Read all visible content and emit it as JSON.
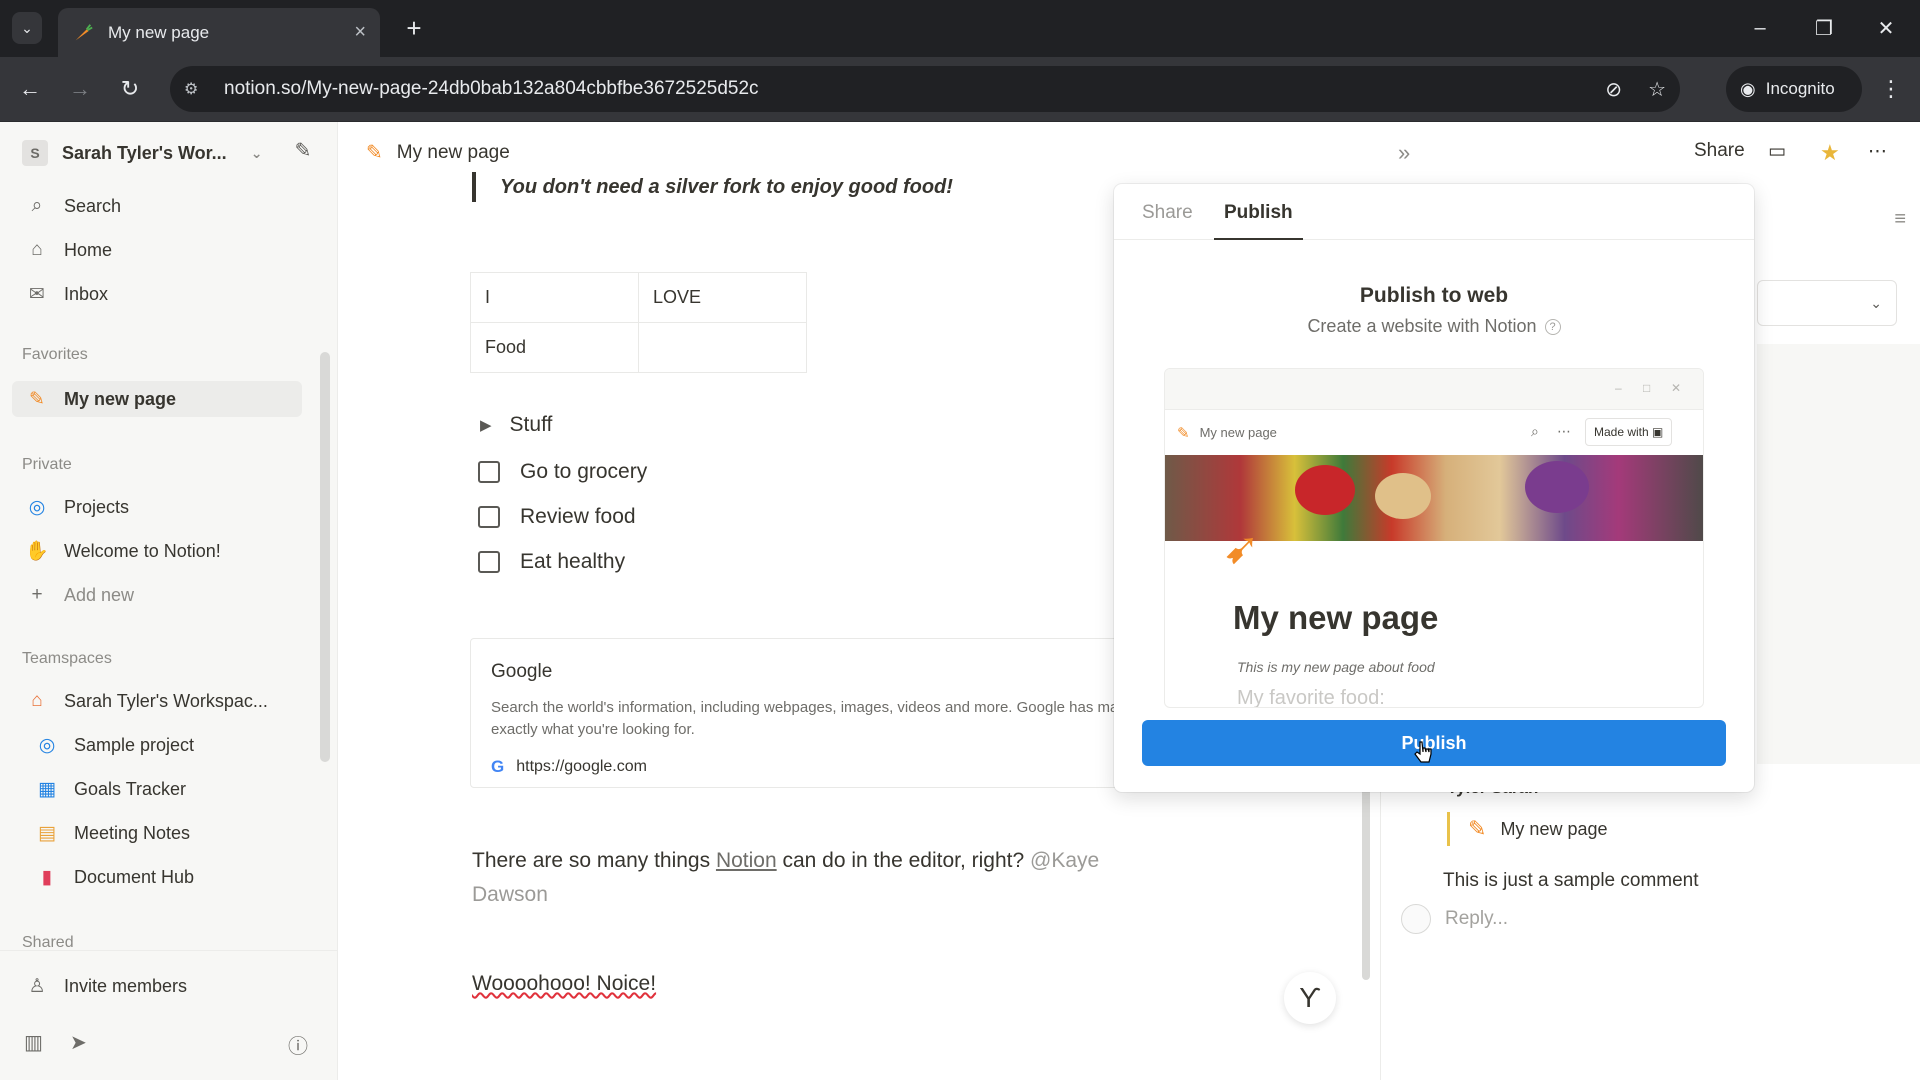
{
  "browser": {
    "tab_title": "My new page",
    "url": "notion.so/My-new-page-24db0bab132a804cbbfbe3672525d52c",
    "incognito_label": "Incognito"
  },
  "sidebar": {
    "workspace_name": "Sarah Tyler's Wor...",
    "workspace_initial": "S",
    "nav": [
      {
        "label": "Search",
        "icon": "search-icon"
      },
      {
        "label": "Home",
        "icon": "home-icon"
      },
      {
        "label": "Inbox",
        "icon": "inbox-icon"
      }
    ],
    "favorites_heading": "Favorites",
    "favorites": [
      {
        "label": "My new page",
        "icon": "carrot-icon"
      }
    ],
    "private_heading": "Private",
    "private": [
      {
        "label": "Projects",
        "icon": "projects-icon"
      },
      {
        "label": "Welcome to Notion!",
        "icon": "wave-icon"
      },
      {
        "label": "Add new",
        "icon": "plus-icon"
      }
    ],
    "teamspaces_heading": "Teamspaces",
    "teamspaces": [
      {
        "label": "Sarah Tyler's Workspac...",
        "icon": "house-icon"
      },
      {
        "label": "Sample project",
        "icon": "target-icon"
      },
      {
        "label": "Goals Tracker",
        "icon": "chart-icon"
      },
      {
        "label": "Meeting Notes",
        "icon": "calendar-icon"
      },
      {
        "label": "Document Hub",
        "icon": "document-icon"
      }
    ],
    "shared_heading": "Shared",
    "invite_label": "Invite members"
  },
  "header": {
    "breadcrumb": "My new page",
    "share_label": "Share"
  },
  "content": {
    "quote": "You don't need a silver fork to enjoy good food!",
    "table": [
      [
        "I",
        "LOVE"
      ],
      [
        "Food",
        ""
      ]
    ],
    "toggle_label": "Stuff",
    "todos": [
      "Go to grocery",
      "Review food",
      "Eat healthy"
    ],
    "bookmark": {
      "title": "Google",
      "description": "Search the world's information, including webpages, images, videos and more. Google has many special features to help you find exactly what you're looking for.",
      "url": "https://google.com"
    },
    "paragraph_before_link": "There are so many things ",
    "paragraph_link": "Notion",
    "paragraph_after_link": " can do in the editor, right? ",
    "paragraph_mention": "@Kaye Dawson",
    "exclaim": "Woooohooo! Noice!"
  },
  "publish_popover": {
    "tab_share": "Share",
    "tab_publish": "Publish",
    "title": "Publish to web",
    "subtitle": "Create a website with Notion",
    "help_glyph": "?",
    "preview": {
      "page_label": "My new page",
      "made_with": "Made with",
      "title": "My new page",
      "line1": "This is my new page about food",
      "line2": "My favorite food:"
    },
    "button_label": "Publish"
  },
  "comments": {
    "author": "Tyler Sarah",
    "quoted_page": "My new page",
    "text": "This is just a sample comment",
    "reply_placeholder": "Reply..."
  }
}
